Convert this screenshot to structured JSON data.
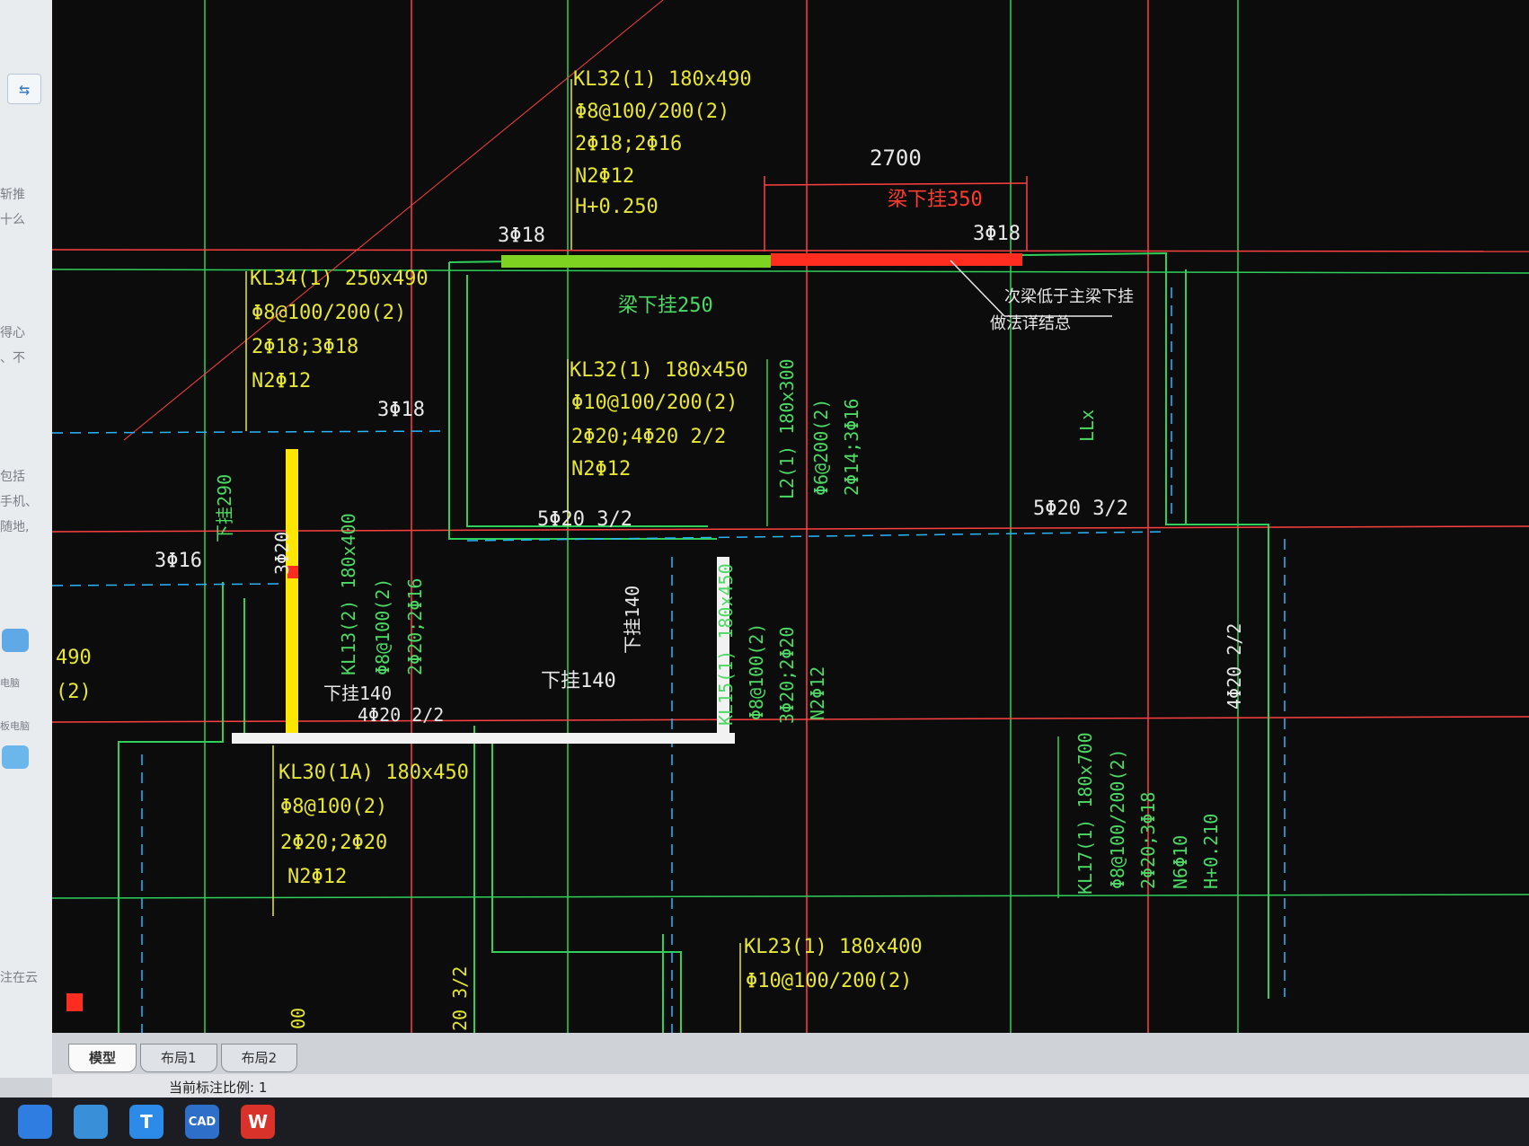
{
  "sidebar": {
    "fragments": [
      "斩推",
      "十么",
      "得心",
      "、不",
      "包括",
      "手机、",
      "随地,",
      "电脑",
      "板电脑",
      "注在云"
    ]
  },
  "drawing": {
    "annotations": [
      {
        "id": "kl32-top-1",
        "text": "KL32(1) 180x490",
        "color": "#e6e633"
      },
      {
        "id": "kl32-top-2",
        "text": "Φ8@100/200(2)",
        "color": "#e6e633"
      },
      {
        "id": "kl32-top-3",
        "text": "2Φ18;2Φ16",
        "color": "#e6e633"
      },
      {
        "id": "kl32-top-4",
        "text": "N2Φ12",
        "color": "#e6e633"
      },
      {
        "id": "kl32-top-5",
        "text": "H+0.250",
        "color": "#e6e633"
      },
      {
        "id": "dim-2700",
        "text": "2700",
        "color": "#e8e8e8"
      },
      {
        "id": "hang-350",
        "text": "梁下挂350",
        "color": "#ff3b30"
      },
      {
        "id": "reb-3-18-a",
        "text": "3Φ18",
        "color": "#e8e8e8"
      },
      {
        "id": "reb-3-18-b",
        "text": "3Φ18",
        "color": "#e8e8e8"
      },
      {
        "id": "note-1",
        "text": "次梁低于主梁下挂",
        "color": "#e8e8e8"
      },
      {
        "id": "note-2",
        "text": "做法详结总",
        "color": "#e8e8e8"
      },
      {
        "id": "hang-250",
        "text": "梁下挂250",
        "color": "#4cd964"
      },
      {
        "id": "kl34-1",
        "text": "KL34(1) 250x490",
        "color": "#e6e633"
      },
      {
        "id": "kl34-2",
        "text": "Φ8@100/200(2)",
        "color": "#e6e633"
      },
      {
        "id": "kl34-3",
        "text": "2Φ18;3Φ18",
        "color": "#e6e633"
      },
      {
        "id": "kl34-4",
        "text": "N2Φ12",
        "color": "#e6e633"
      },
      {
        "id": "reb-3-18-c",
        "text": "3Φ18",
        "color": "#e8e8e8"
      },
      {
        "id": "kl32-mid-1",
        "text": "KL32(1) 180x450",
        "color": "#e6e633"
      },
      {
        "id": "kl32-mid-2",
        "text": "Φ10@100/200(2)",
        "color": "#e6e633"
      },
      {
        "id": "kl32-mid-3",
        "text": "2Φ20;4Φ20 2/2",
        "color": "#e6e633"
      },
      {
        "id": "kl32-mid-4",
        "text": "N2Φ12",
        "color": "#e6e633"
      },
      {
        "id": "reb-5-20-a",
        "text": "5Φ20 3/2",
        "color": "#e8e8e8"
      },
      {
        "id": "reb-5-20-b",
        "text": "5Φ20 3/2",
        "color": "#e8e8e8"
      },
      {
        "id": "reb-3-16",
        "text": "3Φ16",
        "color": "#e8e8e8"
      },
      {
        "id": "kl30-1",
        "text": "KL30(1A) 180x450",
        "color": "#e6e633"
      },
      {
        "id": "kl30-2",
        "text": "Φ8@100(2)",
        "color": "#e6e633"
      },
      {
        "id": "kl30-3",
        "text": "2Φ20;2Φ20",
        "color": "#e6e633"
      },
      {
        "id": "kl30-4",
        "text": "N2Φ12",
        "color": "#e6e633"
      },
      {
        "id": "kl23-1",
        "text": "KL23(1) 180x400",
        "color": "#e6e633"
      },
      {
        "id": "kl23-2",
        "text": "Φ10@100/200(2)",
        "color": "#e6e633"
      },
      {
        "id": "hang-140-h",
        "text": "下挂140",
        "color": "#e8e8e8"
      },
      {
        "id": "hang-140-h2",
        "text": "下挂140",
        "color": "#e8e8e8"
      },
      {
        "id": "reb-4-20-a",
        "text": "4Φ20 2/2",
        "color": "#e8e8e8"
      },
      {
        "id": "left-490",
        "text": "490",
        "color": "#e6e633"
      },
      {
        "id": "left-2",
        "text": "(2)",
        "color": "#e6e633"
      },
      {
        "id": "l2-1",
        "text": "L2(1) 180x300",
        "color": "#4cd964"
      },
      {
        "id": "l2-2",
        "text": "Φ6@200(2)",
        "color": "#4cd964"
      },
      {
        "id": "l2-3",
        "text": "2Φ14;3Φ16",
        "color": "#4cd964"
      },
      {
        "id": "llx",
        "text": "LLx",
        "color": "#4cd964"
      },
      {
        "id": "hang-290",
        "text": "下挂290",
        "color": "#4cd964"
      },
      {
        "id": "reb-3-20",
        "text": "3Φ20",
        "color": "#e8e8e8"
      },
      {
        "id": "kl13-1",
        "text": "KL13(2) 180x400",
        "color": "#4cd964"
      },
      {
        "id": "kl13-2",
        "text": "Φ8@100(2)",
        "color": "#4cd964"
      },
      {
        "id": "kl13-3",
        "text": "2Φ20;2Φ16",
        "color": "#4cd964"
      },
      {
        "id": "hang-140-v",
        "text": "下挂140",
        "color": "#e8e8e8"
      },
      {
        "id": "kl15-1",
        "text": "KL15(1) 180x450",
        "color": "#4cd964"
      },
      {
        "id": "kl15-2",
        "text": "Φ8@100(2)",
        "color": "#4cd964"
      },
      {
        "id": "kl15-3",
        "text": "3Φ20;2Φ20",
        "color": "#4cd964"
      },
      {
        "id": "kl15-4",
        "text": "N2Φ12",
        "color": "#4cd964"
      },
      {
        "id": "reb-4-20-b",
        "text": "4Φ20 2/2",
        "color": "#e8e8e8"
      },
      {
        "id": "kl17-1",
        "text": "KL17(1) 180x700",
        "color": "#4cd964"
      },
      {
        "id": "kl17-2",
        "text": "Φ8@100/200(2)",
        "color": "#4cd964"
      },
      {
        "id": "kl17-3",
        "text": "2Φ20;3Φ18",
        "color": "#4cd964"
      },
      {
        "id": "kl17-4",
        "text": "N6Φ10",
        "color": "#4cd964"
      },
      {
        "id": "kl17-5",
        "text": "H+0.210",
        "color": "#4cd964"
      },
      {
        "id": "bottom-20-32",
        "text": "20 3/2",
        "color": "#e6e633"
      },
      {
        "id": "bottom-00",
        "text": "00",
        "color": "#e6e633"
      }
    ]
  },
  "tabs": [
    {
      "label": "模型",
      "active": true
    },
    {
      "label": "布局1",
      "active": false
    },
    {
      "label": "布局2",
      "active": false
    }
  ],
  "status": {
    "scale_text": "当前标注比例: 1"
  },
  "taskbar": {
    "items": [
      {
        "icon": "explorer-icon",
        "label": "",
        "color": "#2f7de1"
      },
      {
        "icon": "folder-icon",
        "label": "",
        "color": "#3a8fd9"
      },
      {
        "icon": "text-app-icon",
        "label": "T",
        "color": "#2c8ae8"
      },
      {
        "icon": "cad-icon",
        "label": "CAD",
        "color": "#2e6fc9"
      },
      {
        "icon": "wps-icon",
        "label": "W",
        "color": "#d9322b"
      }
    ]
  }
}
